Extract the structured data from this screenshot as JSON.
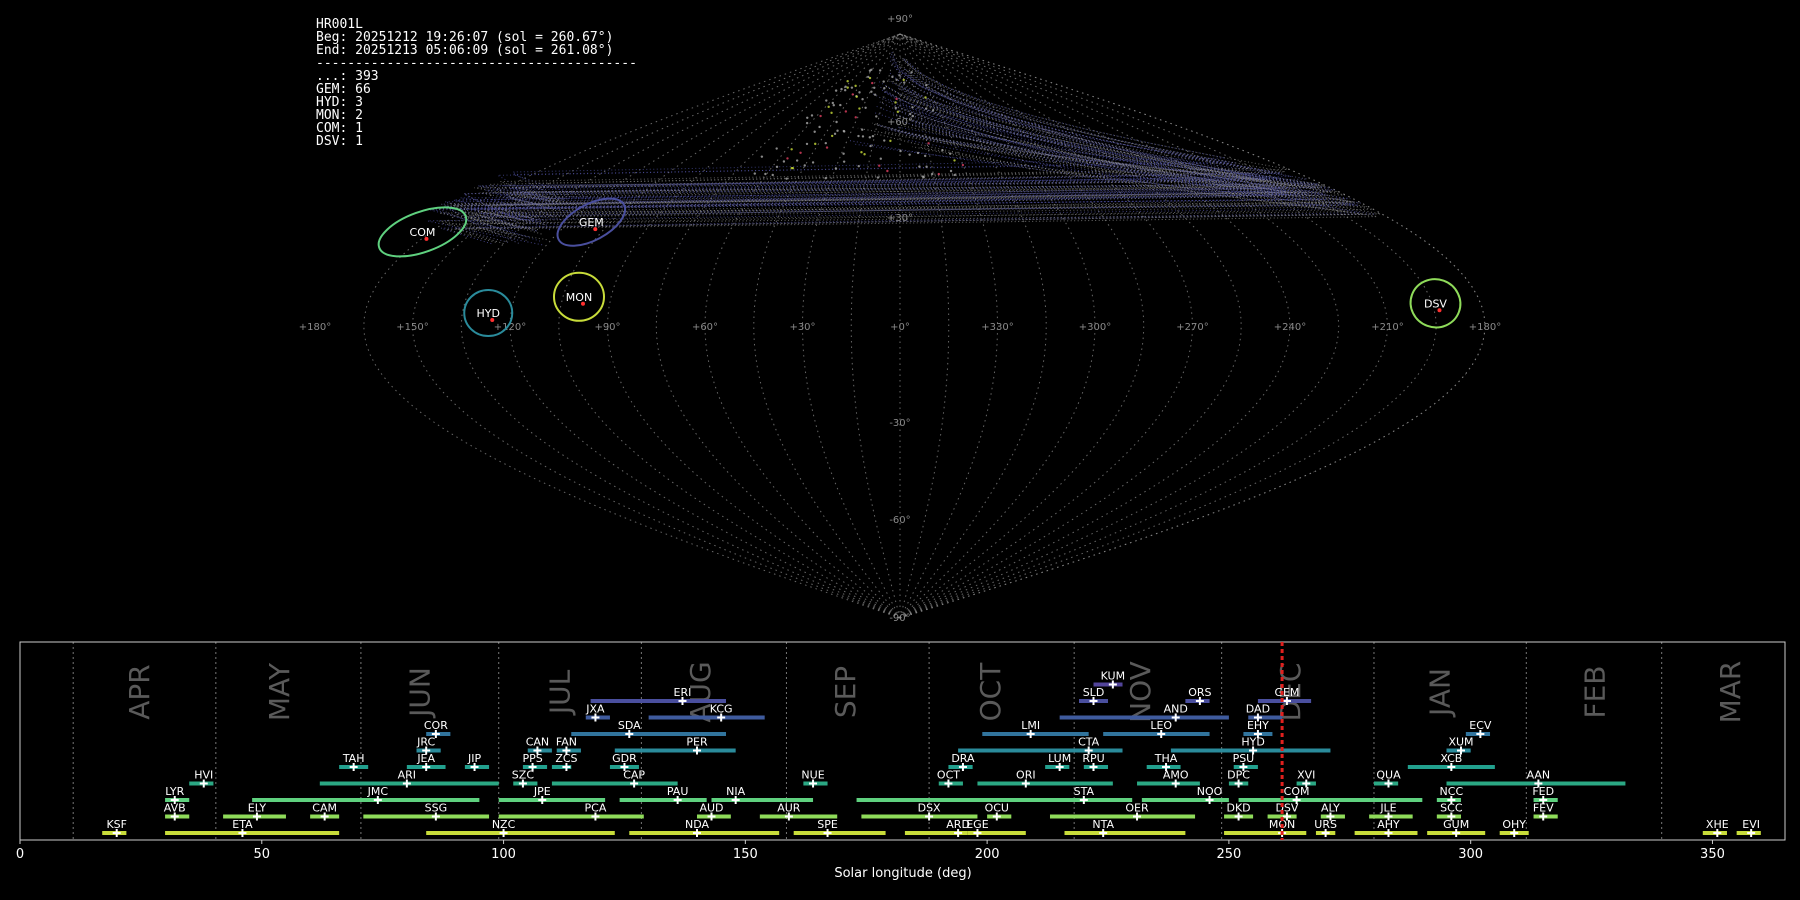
{
  "info": {
    "station": "HR001L",
    "beg": "Beg: 20251212 19:26:07 (sol = 260.67°)",
    "end": "End: 20251213 05:06:09 (sol = 261.08°)",
    "separator": "-----------------------------------------",
    "counts": [
      {
        "code": "...",
        "n": 393
      },
      {
        "code": "GEM",
        "n": 66
      },
      {
        "code": "HYD",
        "n": 3
      },
      {
        "code": "MON",
        "n": 2
      },
      {
        "code": "COM",
        "n": 1
      },
      {
        "code": "DSV",
        "n": 1
      }
    ]
  },
  "chart_data": [
    {
      "type": "scatter",
      "projection": "sinusoidal",
      "lon_ticks": [
        "+180°",
        "+150°",
        "+120°",
        "+90°",
        "+60°",
        "+30°",
        "+0°",
        "+330°",
        "+300°",
        "+270°",
        "+240°",
        "+210°",
        "+180°"
      ],
      "lat_ticks": [
        "+90°",
        "+60°",
        "+30°",
        "-30°",
        "-60°",
        "-90°"
      ],
      "lon_direction": "decreasing-left-to-right",
      "grid": true,
      "showers": [
        {
          "code": "COM",
          "lon": 168,
          "lat": 29,
          "color": "#5fd17f"
        },
        {
          "code": "GEM",
          "lon": 112,
          "lat": 32,
          "color": "#4a4f9e"
        },
        {
          "code": "MON",
          "lon": 100,
          "lat": 9,
          "color": "#c8dc3a"
        },
        {
          "code": "HYD",
          "lon": 127,
          "lat": 4,
          "color": "#2a8b9b"
        },
        {
          "code": "DSV",
          "lon": 194,
          "lat": 7,
          "color": "#8fdb5a"
        }
      ]
    },
    {
      "type": "timeline",
      "xlabel": "Solar longitude (deg)",
      "xlim": [
        0,
        365
      ],
      "xticks": [
        0,
        50,
        100,
        150,
        200,
        250,
        300,
        350
      ],
      "current_sol": 261,
      "months": [
        {
          "name": "APR",
          "start": 11,
          "label_at": 25
        },
        {
          "name": "MAY",
          "start": 40.5,
          "label_at": 54
        },
        {
          "name": "JUN",
          "start": 70.5,
          "label_at": 83
        },
        {
          "name": "JUL",
          "start": 99,
          "label_at": 112
        },
        {
          "name": "AUG",
          "start": 128.5,
          "label_at": 141
        },
        {
          "name": "SEP",
          "start": 158.5,
          "label_at": 171
        },
        {
          "name": "OCT",
          "start": 188,
          "label_at": 201
        },
        {
          "name": "NOV",
          "start": 218,
          "label_at": 232
        },
        {
          "name": "DEC",
          "start": 248.5,
          "label_at": 263
        },
        {
          "name": "JAN",
          "start": 280,
          "label_at": 294
        },
        {
          "name": "FEB",
          "start": 311.5,
          "label_at": 326
        },
        {
          "name": "MAR",
          "start": 339.5,
          "label_at": 354
        }
      ],
      "showers": [
        {
          "code": "KSF",
          "row": 0,
          "start": 17,
          "end": 22,
          "peak": 20,
          "color": "#c8dc3a"
        },
        {
          "code": "ETA",
          "row": 0,
          "start": 30,
          "end": 66,
          "peak": 46,
          "color": "#c8dc3a"
        },
        {
          "code": "NZC",
          "row": 0,
          "start": 84,
          "end": 123,
          "peak": 100,
          "color": "#c8dc3a"
        },
        {
          "code": "NDA",
          "row": 0,
          "start": 126,
          "end": 157,
          "peak": 140,
          "color": "#c8dc3a"
        },
        {
          "code": "SPE",
          "row": 0,
          "start": 160,
          "end": 179,
          "peak": 167,
          "color": "#c8dc3a"
        },
        {
          "code": "ARD",
          "row": 0,
          "start": 183,
          "end": 196,
          "peak": 194,
          "color": "#c8dc3a"
        },
        {
          "code": "EGE",
          "row": 0,
          "start": 196,
          "end": 208,
          "peak": 198,
          "color": "#c8dc3a"
        },
        {
          "code": "NTA",
          "row": 0,
          "start": 216,
          "end": 241,
          "peak": 224,
          "color": "#c8dc3a"
        },
        {
          "code": "MON",
          "row": 0,
          "start": 249,
          "end": 266,
          "peak": 261,
          "color": "#c8dc3a"
        },
        {
          "code": "URS",
          "row": 0,
          "start": 268,
          "end": 272,
          "peak": 270,
          "color": "#c8dc3a"
        },
        {
          "code": "AHY",
          "row": 0,
          "start": 276,
          "end": 289,
          "peak": 283,
          "color": "#c8dc3a"
        },
        {
          "code": "GUM",
          "row": 0,
          "start": 291,
          "end": 303,
          "peak": 297,
          "color": "#c8dc3a"
        },
        {
          "code": "OHY",
          "row": 0,
          "start": 306,
          "end": 312,
          "peak": 309,
          "color": "#c8dc3a"
        },
        {
          "code": "XHE",
          "row": 0,
          "start": 348,
          "end": 353,
          "peak": 351,
          "color": "#c8dc3a"
        },
        {
          "code": "EVI",
          "row": 0,
          "start": 355,
          "end": 360,
          "peak": 358,
          "color": "#c8dc3a"
        },
        {
          "code": "AVB",
          "row": 1,
          "start": 30,
          "end": 35,
          "peak": 32,
          "color": "#8fdb5a"
        },
        {
          "code": "ELY",
          "row": 1,
          "start": 42,
          "end": 55,
          "peak": 49,
          "color": "#8fdb5a"
        },
        {
          "code": "CAM",
          "row": 1,
          "start": 60,
          "end": 66,
          "peak": 63,
          "color": "#8fdb5a"
        },
        {
          "code": "SSG",
          "row": 1,
          "start": 71,
          "end": 97,
          "peak": 86,
          "color": "#8fdb5a"
        },
        {
          "code": "PCA",
          "row": 1,
          "start": 99,
          "end": 129,
          "peak": 119,
          "color": "#8fdb5a"
        },
        {
          "code": "AUD",
          "row": 1,
          "start": 140,
          "end": 147,
          "peak": 143,
          "color": "#8fdb5a"
        },
        {
          "code": "AUR",
          "row": 1,
          "start": 153,
          "end": 169,
          "peak": 159,
          "color": "#8fdb5a"
        },
        {
          "code": "DSX",
          "row": 1,
          "start": 174,
          "end": 198,
          "peak": 188,
          "color": "#8fdb5a"
        },
        {
          "code": "OCU",
          "row": 1,
          "start": 200,
          "end": 205,
          "peak": 202,
          "color": "#8fdb5a"
        },
        {
          "code": "OER",
          "row": 1,
          "start": 213,
          "end": 243,
          "peak": 231,
          "color": "#8fdb5a"
        },
        {
          "code": "DKD",
          "row": 1,
          "start": 249,
          "end": 255,
          "peak": 252,
          "color": "#8fdb5a"
        },
        {
          "code": "DSV",
          "row": 1,
          "start": 258,
          "end": 264,
          "peak": 262,
          "color": "#8fdb5a"
        },
        {
          "code": "ALY",
          "row": 1,
          "start": 269,
          "end": 274,
          "peak": 271,
          "color": "#8fdb5a"
        },
        {
          "code": "JLE",
          "row": 1,
          "start": 279,
          "end": 288,
          "peak": 283,
          "color": "#8fdb5a"
        },
        {
          "code": "SCC",
          "row": 1,
          "start": 293,
          "end": 298,
          "peak": 296,
          "color": "#8fdb5a"
        },
        {
          "code": "FEV",
          "row": 1,
          "start": 313,
          "end": 318,
          "peak": 315,
          "color": "#8fdb5a"
        },
        {
          "code": "LYR",
          "row": 2,
          "start": 30,
          "end": 35,
          "peak": 32,
          "color": "#5fd17f"
        },
        {
          "code": "JMC",
          "row": 2,
          "start": 48,
          "end": 95,
          "peak": 74,
          "color": "#5fd17f"
        },
        {
          "code": "JPE",
          "row": 2,
          "start": 99,
          "end": 121,
          "peak": 108,
          "color": "#5fd17f"
        },
        {
          "code": "PAU",
          "row": 2,
          "start": 124,
          "end": 142,
          "peak": 136,
          "color": "#5fd17f"
        },
        {
          "code": "NIA",
          "row": 2,
          "start": 143,
          "end": 164,
          "peak": 148,
          "color": "#5fd17f"
        },
        {
          "code": "STA",
          "row": 2,
          "start": 173,
          "end": 230,
          "peak": 220,
          "color": "#5fd17f"
        },
        {
          "code": "NOO",
          "row": 2,
          "start": 232,
          "end": 250,
          "peak": 246,
          "color": "#5fd17f"
        },
        {
          "code": "COM",
          "row": 2,
          "start": 252,
          "end": 290,
          "peak": 264,
          "color": "#5fd17f"
        },
        {
          "code": "NCC",
          "row": 2,
          "start": 293,
          "end": 298,
          "peak": 296,
          "color": "#5fd17f"
        },
        {
          "code": "FED",
          "row": 2,
          "start": 313,
          "end": 318,
          "peak": 315,
          "color": "#5fd17f"
        },
        {
          "code": "HVI",
          "row": 3,
          "start": 35,
          "end": 40,
          "peak": 38,
          "color": "#2ba884"
        },
        {
          "code": "ARI",
          "row": 3,
          "start": 62,
          "end": 99,
          "peak": 80,
          "color": "#2ba884"
        },
        {
          "code": "SZC",
          "row": 3,
          "start": 102,
          "end": 107,
          "peak": 104,
          "color": "#2ba884"
        },
        {
          "code": "CAP",
          "row": 3,
          "start": 110,
          "end": 136,
          "peak": 127,
          "color": "#2ba884"
        },
        {
          "code": "NUE",
          "row": 3,
          "start": 162,
          "end": 167,
          "peak": 164,
          "color": "#2ba884"
        },
        {
          "code": "OCT",
          "row": 3,
          "start": 190,
          "end": 195,
          "peak": 192,
          "color": "#2ba884"
        },
        {
          "code": "ORI",
          "row": 3,
          "start": 198,
          "end": 226,
          "peak": 208,
          "color": "#2ba884"
        },
        {
          "code": "AMO",
          "row": 3,
          "start": 231,
          "end": 244,
          "peak": 239,
          "color": "#2ba884"
        },
        {
          "code": "DPC",
          "row": 3,
          "start": 250,
          "end": 254,
          "peak": 252,
          "color": "#2ba884"
        },
        {
          "code": "XVI",
          "row": 3,
          "start": 264,
          "end": 268,
          "peak": 266,
          "color": "#2ba884"
        },
        {
          "code": "QUA",
          "row": 3,
          "start": 280,
          "end": 285,
          "peak": 283,
          "color": "#2ba884"
        },
        {
          "code": "AAN",
          "row": 3,
          "start": 295,
          "end": 332,
          "peak": 314,
          "color": "#2ba884"
        },
        {
          "code": "TAH",
          "row": 4,
          "start": 66,
          "end": 72,
          "peak": 69,
          "color": "#22a08e"
        },
        {
          "code": "JEA",
          "row": 4,
          "start": 80,
          "end": 88,
          "peak": 84,
          "color": "#22a08e"
        },
        {
          "code": "JIP",
          "row": 4,
          "start": 92,
          "end": 97,
          "peak": 94,
          "color": "#22a08e"
        },
        {
          "code": "PPS",
          "row": 4,
          "start": 104,
          "end": 109,
          "peak": 106,
          "color": "#22a08e"
        },
        {
          "code": "ZCS",
          "row": 4,
          "start": 110,
          "end": 114,
          "peak": 113,
          "color": "#22a08e"
        },
        {
          "code": "GDR",
          "row": 4,
          "start": 122,
          "end": 128,
          "peak": 125,
          "color": "#22a08e"
        },
        {
          "code": "DRA",
          "row": 4,
          "start": 192,
          "end": 197,
          "peak": 195,
          "color": "#22a08e"
        },
        {
          "code": "LUM",
          "row": 4,
          "start": 212,
          "end": 217,
          "peak": 215,
          "color": "#22a08e"
        },
        {
          "code": "RPU",
          "row": 4,
          "start": 220,
          "end": 225,
          "peak": 222,
          "color": "#22a08e"
        },
        {
          "code": "THA",
          "row": 4,
          "start": 233,
          "end": 240,
          "peak": 237,
          "color": "#22a08e"
        },
        {
          "code": "PSU",
          "row": 4,
          "start": 251,
          "end": 256,
          "peak": 253,
          "color": "#22a08e"
        },
        {
          "code": "XCB",
          "row": 4,
          "start": 287,
          "end": 305,
          "peak": 296,
          "color": "#22a08e"
        },
        {
          "code": "JRC",
          "row": 5,
          "start": 82,
          "end": 87,
          "peak": 84,
          "color": "#2a8b9b"
        },
        {
          "code": "CAN",
          "row": 5,
          "start": 105,
          "end": 110,
          "peak": 107,
          "color": "#2a8b9b"
        },
        {
          "code": "FAN",
          "row": 5,
          "start": 111,
          "end": 116,
          "peak": 113,
          "color": "#2a8b9b"
        },
        {
          "code": "PER",
          "row": 5,
          "start": 123,
          "end": 148,
          "peak": 140,
          "color": "#2a8b9b"
        },
        {
          "code": "CTA",
          "row": 5,
          "start": 194,
          "end": 228,
          "peak": 221,
          "color": "#2a8b9b"
        },
        {
          "code": "HYD",
          "row": 5,
          "start": 238,
          "end": 271,
          "peak": 255,
          "color": "#2a8b9b"
        },
        {
          "code": "XUM",
          "row": 5,
          "start": 295,
          "end": 300,
          "peak": 298,
          "color": "#2a8b9b"
        },
        {
          "code": "COR",
          "row": 6,
          "start": 84,
          "end": 89,
          "peak": 86,
          "color": "#31749d"
        },
        {
          "code": "SDA",
          "row": 6,
          "start": 114,
          "end": 146,
          "peak": 126,
          "color": "#31749d"
        },
        {
          "code": "LMI",
          "row": 6,
          "start": 199,
          "end": 221,
          "peak": 209,
          "color": "#31749d"
        },
        {
          "code": "LEO",
          "row": 6,
          "start": 224,
          "end": 246,
          "peak": 236,
          "color": "#31749d"
        },
        {
          "code": "EHY",
          "row": 6,
          "start": 253,
          "end": 259,
          "peak": 256,
          "color": "#31749d"
        },
        {
          "code": "ECV",
          "row": 6,
          "start": 299,
          "end": 304,
          "peak": 302,
          "color": "#31749d"
        },
        {
          "code": "JXA",
          "row": 7,
          "start": 117,
          "end": 122,
          "peak": 119,
          "color": "#3f5b9e"
        },
        {
          "code": "KCG",
          "row": 7,
          "start": 130,
          "end": 154,
          "peak": 145,
          "color": "#3f5b9e"
        },
        {
          "code": "AND",
          "row": 7,
          "start": 215,
          "end": 250,
          "peak": 239,
          "color": "#3f5b9e"
        },
        {
          "code": "DAD",
          "row": 7,
          "start": 254,
          "end": 261,
          "peak": 256,
          "color": "#3f5b9e"
        },
        {
          "code": "ERI",
          "row": 8,
          "start": 118,
          "end": 146,
          "peak": 137,
          "color": "#4a4f9e"
        },
        {
          "code": "SLD",
          "row": 8,
          "start": 219,
          "end": 225,
          "peak": 222,
          "color": "#4a4f9e"
        },
        {
          "code": "ORS",
          "row": 8,
          "start": 241,
          "end": 246,
          "peak": 244,
          "color": "#4a4f9e"
        },
        {
          "code": "GEM",
          "row": 8,
          "start": 256,
          "end": 267,
          "peak": 262,
          "color": "#4a4f9e"
        },
        {
          "code": "KUM",
          "row": 9,
          "start": 222,
          "end": 228,
          "peak": 226,
          "color": "#52449a"
        }
      ]
    }
  ]
}
